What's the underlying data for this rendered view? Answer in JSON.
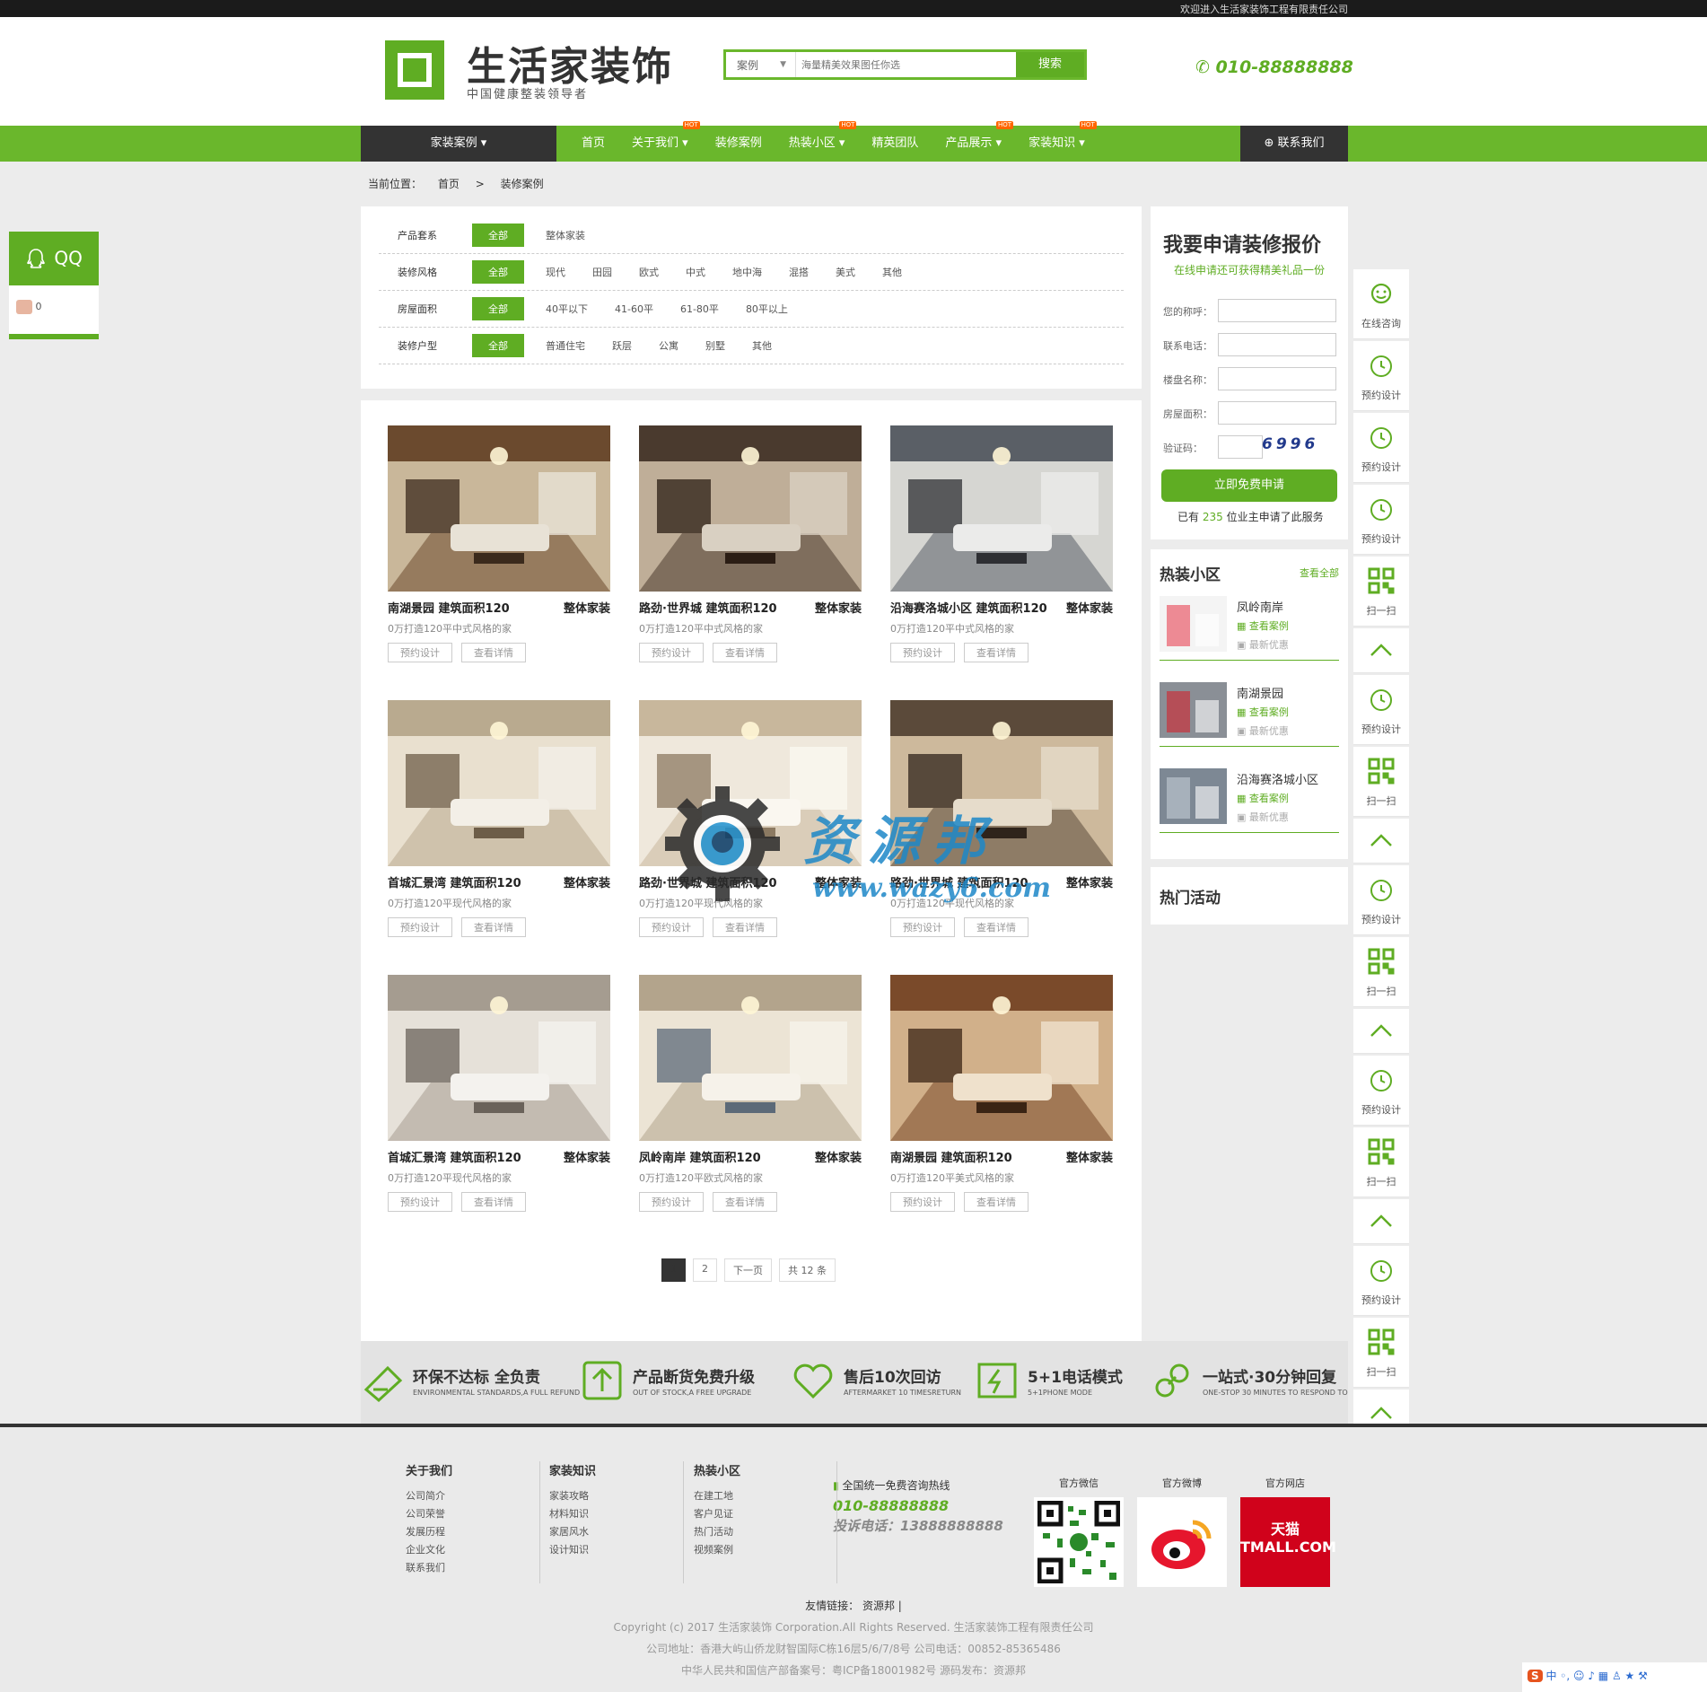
{
  "topbar": {
    "welcome": "欢迎进入生活家装饰工程有限责任公司"
  },
  "header": {
    "logo_title": "生活家装饰",
    "logo_sub": "中国健康整装领导者",
    "search_type": "案例",
    "search_placeholder": "海量精美效果图任你选",
    "search_button": "搜索",
    "phone": "010-88888888"
  },
  "nav": {
    "category": "家装案例 ▾",
    "items": [
      {
        "label": "首页",
        "hot": ""
      },
      {
        "label": "关于我们 ▾",
        "hot": "HOT"
      },
      {
        "label": "装修案例",
        "hot": ""
      },
      {
        "label": "热装小区 ▾",
        "hot": "HOT"
      },
      {
        "label": "精英团队",
        "hot": ""
      },
      {
        "label": "产品展示 ▾",
        "hot": "HOT"
      },
      {
        "label": "家装知识 ▾",
        "hot": "HOT"
      }
    ],
    "contact": "联系我们"
  },
  "breadcrumb": {
    "label": "当前位置：",
    "home": "首页",
    "sep": ">",
    "current": "装修案例"
  },
  "filters": [
    {
      "label": "产品套系",
      "options": [
        "全部",
        "整体家装"
      ]
    },
    {
      "label": "装修风格",
      "options": [
        "全部",
        "现代",
        "田园",
        "欧式",
        "中式",
        "地中海",
        "混搭",
        "美式",
        "其他"
      ]
    },
    {
      "label": "房屋面积",
      "options": [
        "全部",
        "40平以下",
        "41-60平",
        "61-80平",
        "80平以上"
      ]
    },
    {
      "label": "装修户型",
      "options": [
        "全部",
        "普通住宅",
        "跃层",
        "公寓",
        "别墅",
        "其他"
      ]
    }
  ],
  "cases": [
    {
      "title": "南湖景园 建筑面积120",
      "tag": "整体家装",
      "desc": "0万打造120平中式风格的家",
      "b1": "预约设计",
      "b2": "查看详情"
    },
    {
      "title": "路劲·世界城 建筑面积120",
      "tag": "整体家装",
      "desc": "0万打造120平中式风格的家",
      "b1": "预约设计",
      "b2": "查看详情"
    },
    {
      "title": "沿海赛洛城小区 建筑面积120",
      "tag": "整体家装",
      "desc": "0万打造120平中式风格的家",
      "b1": "预约设计",
      "b2": "查看详情"
    },
    {
      "title": "首城汇景湾 建筑面积120",
      "tag": "整体家装",
      "desc": "0万打造120平现代风格的家",
      "b1": "预约设计",
      "b2": "查看详情"
    },
    {
      "title": "路劲·世界城 建筑面积120",
      "tag": "整体家装",
      "desc": "0万打造120平现代风格的家",
      "b1": "预约设计",
      "b2": "查看详情"
    },
    {
      "title": "路劲·世界城 建筑面积120",
      "tag": "整体家装",
      "desc": "0万打造120平现代风格的家",
      "b1": "预约设计",
      "b2": "查看详情"
    },
    {
      "title": "首城汇景湾 建筑面积120",
      "tag": "整体家装",
      "desc": "0万打造120平现代风格的家",
      "b1": "预约设计",
      "b2": "查看详情"
    },
    {
      "title": "凤岭南岸 建筑面积120",
      "tag": "整体家装",
      "desc": "0万打造120平欧式风格的家",
      "b1": "预约设计",
      "b2": "查看详情"
    },
    {
      "title": "南湖景园 建筑面积120",
      "tag": "整体家装",
      "desc": "0万打造120平美式风格的家",
      "b1": "预约设计",
      "b2": "查看详情"
    }
  ],
  "pager": {
    "p1": "1",
    "p2": "2",
    "next": "下一页",
    "total": "共 12 条"
  },
  "quote": {
    "title": "我要申请装修报价",
    "sub": "在线申请还可获得精美礼品一份",
    "f1": "您的称呼：",
    "f2": "联系电话：",
    "f3": "楼盘名称：",
    "f4": "房屋面积：",
    "f5": "验证码：",
    "captcha": "6996",
    "apply": "立即免费申请",
    "count_pre": "已有",
    "count": "235",
    "count_post": "位业主申请了此服务"
  },
  "hot_areas": {
    "title": "热装小区",
    "all": "查看全部",
    "items": [
      {
        "name": "凤岭南岸",
        "a": "查看案例",
        "b": "最新优惠"
      },
      {
        "name": "南湖景园",
        "a": "查看案例",
        "b": "最新优惠"
      },
      {
        "name": "沿海赛洛城小区",
        "a": "查看案例",
        "b": "最新优惠"
      }
    ]
  },
  "activity": {
    "title": "热门活动"
  },
  "qq": {
    "label": "QQ",
    "count": "0"
  },
  "rail": [
    "在线咨询",
    "预约设计",
    "预约设计",
    "预约设计",
    "扫一扫",
    "",
    "预约设计",
    "扫一扫",
    "",
    "预约设计",
    "扫一扫",
    "",
    "预约设计",
    "扫一扫",
    "",
    "预约设计",
    "扫一扫",
    "返回顶部"
  ],
  "guarantees": [
    {
      "t": "环保不达标 全负责",
      "e": "ENVIRONMENTAL STANDARDS,A FULL REFUND"
    },
    {
      "t": "产品断货免费升级",
      "e": "OUT OF STOCK,A FREE UPGRADE"
    },
    {
      "t": "售后10次回访",
      "e": "AFTERMARKET 10 TIMESRETURN"
    },
    {
      "t": "5+1电话模式",
      "e": "5+1PHONE MODE"
    },
    {
      "t": "一站式·30分钟回复",
      "e": "ONE-STOP 30 MINUTES TO RESPOND TO"
    }
  ],
  "footer": {
    "cols": [
      {
        "title": "关于我们",
        "links": [
          "公司简介",
          "公司荣誉",
          "发展历程",
          "企业文化",
          "联系我们"
        ]
      },
      {
        "title": "家装知识",
        "links": [
          "家装攻略",
          "材料知识",
          "家居风水",
          "设计知识"
        ]
      },
      {
        "title": "热装小区",
        "links": [
          "在建工地",
          "客户见证",
          "热门活动",
          "视频案例"
        ]
      }
    ],
    "hotline_label": "全国统一免费咨询热线",
    "hotline": "010-88888888",
    "complaint": "投诉电话：13888888888",
    "wechat": "官方微信",
    "weibo": "官方微博",
    "shop": "官方网店",
    "tmall": "天猫 TMALL.COM",
    "links_label": "友情链接：",
    "links": "资源邦 |",
    "copyright": "Copyright (c) 2017 生活家装饰 Corporation.All Rights Reserved. 生活家装饰工程有限责任公司",
    "address": "公司地址：香港大屿山侨龙财智国际C栋16层5/6/7/8号 公司电话：00852-85365486",
    "icp": "中华人民共和国信产部备案号：粤ICP备18001982号 源码发布：资源邦"
  },
  "watermark": {
    "cn": "资源邦",
    "url": "www.wazy6.com"
  },
  "colors": {
    "brand": "#5fad23",
    "dark": "#333333"
  }
}
